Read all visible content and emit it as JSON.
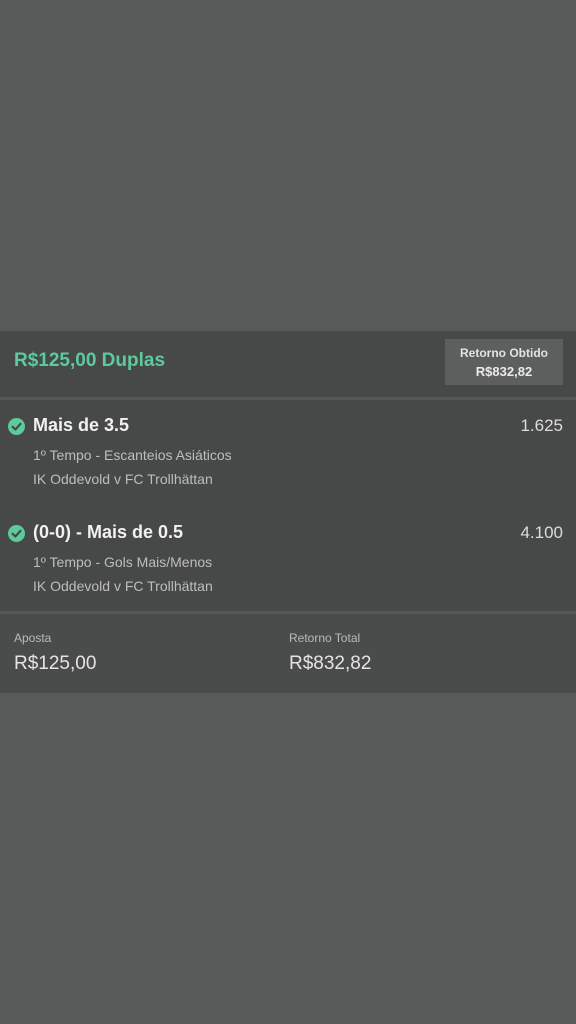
{
  "header": {
    "title": "R$125,00 Duplas",
    "return_label": "Retorno Obtido",
    "return_value": "R$832,82"
  },
  "selections": [
    {
      "title": "Mais de 3.5",
      "odds": "1.625",
      "market": "1º Tempo - Escanteios Asiáticos",
      "event": "IK Oddevold v FC Trollhättan",
      "status_icon": "check-circle-icon"
    },
    {
      "title": "(0-0) - Mais de 0.5",
      "odds": "4.100",
      "market": "1º Tempo - Gols Mais/Menos",
      "event": "IK Oddevold v FC Trollhättan",
      "status_icon": "check-circle-icon"
    }
  ],
  "footer": {
    "stake_label": "Aposta",
    "stake_value": "R$125,00",
    "total_label": "Retorno Total",
    "total_value": "R$832,82"
  },
  "colors": {
    "accent": "#5ccb9c",
    "background": "#585a59",
    "card": "#474948"
  }
}
